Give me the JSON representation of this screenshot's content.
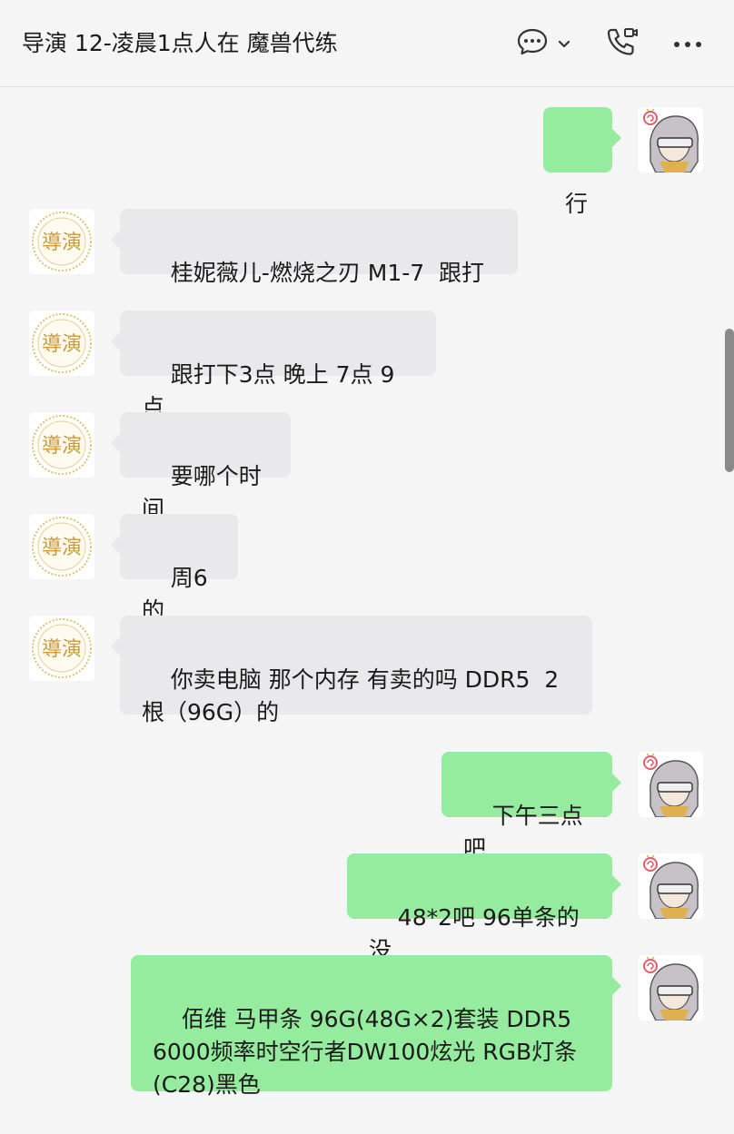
{
  "header": {
    "title": "导演 12-凌晨1点人在 魔兽代练",
    "icons": [
      "chat-bubble-icon",
      "chevron-down-icon",
      "video-call-icon",
      "more-icon"
    ]
  },
  "contacts": {
    "other_avatar_text": "導演",
    "self_avatar": "cartoon-character"
  },
  "messages": [
    {
      "side": "right",
      "text": "行"
    },
    {
      "side": "left",
      "text": "桂妮薇儿-燃烧之刃 M1-7  跟打"
    },
    {
      "side": "left",
      "text": "跟打下3点 晚上 7点 9点"
    },
    {
      "side": "left",
      "text": "要哪个时间"
    },
    {
      "side": "left",
      "text": "周6 的"
    },
    {
      "side": "left",
      "text": "你卖电脑 那个内存 有卖的吗 DDR5  2根（96G）的"
    },
    {
      "side": "right",
      "text": "下午三点吧"
    },
    {
      "side": "right",
      "text": "48*2吧 96单条的没"
    },
    {
      "side": "right",
      "text": "佰维 马甲条 96G(48G×2)套装 DDR5 6000频率时空行者DW100炫光 RGB灯条(C28)黑色"
    }
  ],
  "colors": {
    "self_bubble": "#95ec9e",
    "other_bubble": "#e9e9eb",
    "background": "#f5f5f5"
  }
}
